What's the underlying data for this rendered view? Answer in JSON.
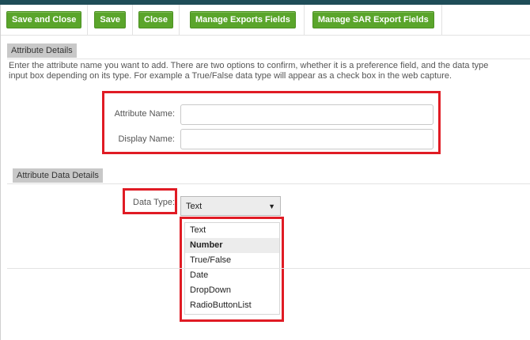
{
  "toolbar": {
    "save_close": "Save and Close",
    "save": "Save",
    "close": "Close",
    "manage_exports": "Manage Exports Fields",
    "manage_sar": "Manage SAR Export Fields"
  },
  "attribute_details": {
    "heading": "Attribute Details",
    "description_line1": "Enter the attribute name you want to add. There are two options to confirm, whether it is a preference field, and the data type",
    "description_line2": "input box depending on its type. For example a True/False data type will appear as a check box in the web capture.",
    "attribute_name_label": "Attribute Name:",
    "attribute_name_value": "",
    "display_name_label": "Display Name:",
    "display_name_value": ""
  },
  "data_details": {
    "heading": "Attribute Data Details",
    "data_type_label": "Data Type:",
    "selected": "Text",
    "options": [
      "Text",
      "Number",
      "True/False",
      "Date",
      "DropDown",
      "RadioButtonList"
    ],
    "highlighted_option": "Number"
  },
  "colors": {
    "button_green": "#5aa52b",
    "highlight_red": "#e01b24",
    "header_bg": "#1e4d58"
  }
}
